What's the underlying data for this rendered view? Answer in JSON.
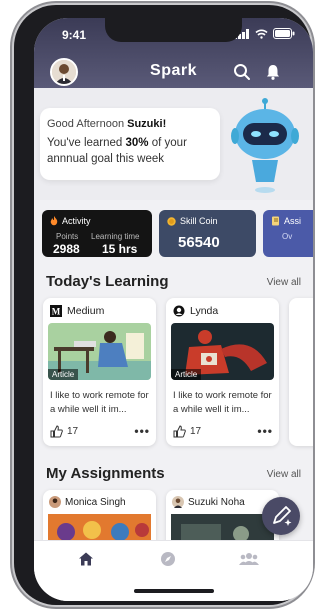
{
  "status_bar": {
    "time": "9:41"
  },
  "header": {
    "title": "Spark"
  },
  "greeting": {
    "salutation": "Good Afternoon",
    "user_name": "Suzuki!",
    "progress_prefix": "You've learned",
    "progress_percent": "30%",
    "progress_suffix": "of your annnual goal this week"
  },
  "stats": {
    "activity": {
      "title": "Activity",
      "points_label": "Points",
      "points_value": "2988",
      "time_label": "Learning time",
      "time_value": "15 hrs"
    },
    "skill_coin": {
      "title": "Skill Coin",
      "value": "56540"
    },
    "assignments": {
      "title": "Assi",
      "sub": "Ov"
    }
  },
  "todays_learning": {
    "title": "Today's Learning",
    "view_all": "View all",
    "cards": [
      {
        "source": "Medium",
        "tag": "Article",
        "text": "I like to work remote for a while well it im...",
        "likes": "17",
        "more": "•••"
      },
      {
        "source": "Lynda",
        "tag": "Article",
        "text": "I like to work remote for a while well it im...",
        "likes": "17",
        "more": "•••"
      }
    ]
  },
  "my_assignments": {
    "title": "My Assignments",
    "view_all": "View all",
    "cards": [
      {
        "name": "Monica Singh"
      },
      {
        "name": "Suzuki Noha"
      }
    ]
  },
  "colors": {
    "header": "#45455f",
    "activity_card": "#141414",
    "skill_card": "#3d4a66",
    "assign_card": "#4b5aa8"
  }
}
